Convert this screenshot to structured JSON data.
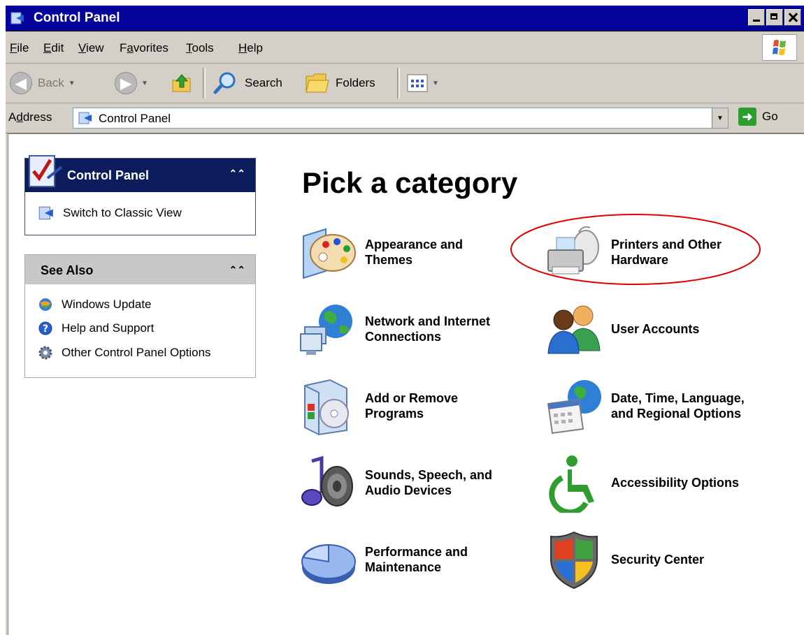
{
  "window": {
    "title": "Control Panel"
  },
  "menu": [
    "File",
    "Edit",
    "View",
    "Favorites",
    "Tools",
    "Help"
  ],
  "menu_mnemonic_index": [
    0,
    0,
    0,
    1,
    0,
    0
  ],
  "toolbar": {
    "back": "Back",
    "search": "Search",
    "folders": "Folders"
  },
  "address": {
    "label": "Address",
    "value": "Control Panel",
    "go": "Go"
  },
  "left_panel": {
    "control_panel": {
      "title": "Control Panel",
      "link": "Switch to Classic View"
    },
    "see_also": {
      "title": "See Also",
      "links": [
        "Windows Update",
        "Help and Support",
        "Other Control Panel Options"
      ]
    }
  },
  "main": {
    "heading": "Pick a category",
    "categories": [
      {
        "label1": "Appearance and",
        "label2": "Themes"
      },
      {
        "label1": "Printers and Other",
        "label2": "Hardware"
      },
      {
        "label1": "Network and Internet",
        "label2": "Connections"
      },
      {
        "label1": "User Accounts",
        "label2": ""
      },
      {
        "label1": "Add or Remove",
        "label2": "Programs"
      },
      {
        "label1": "Date, Time, Language,",
        "label2": "and Regional Options"
      },
      {
        "label1": "Sounds, Speech, and",
        "label2": "Audio Devices"
      },
      {
        "label1": "Accessibility Options",
        "label2": ""
      },
      {
        "label1": "Performance and",
        "label2": "Maintenance"
      },
      {
        "label1": "Security Center",
        "label2": ""
      }
    ],
    "highlighted_category_index": 1,
    "highlight_color": "#e00000"
  }
}
